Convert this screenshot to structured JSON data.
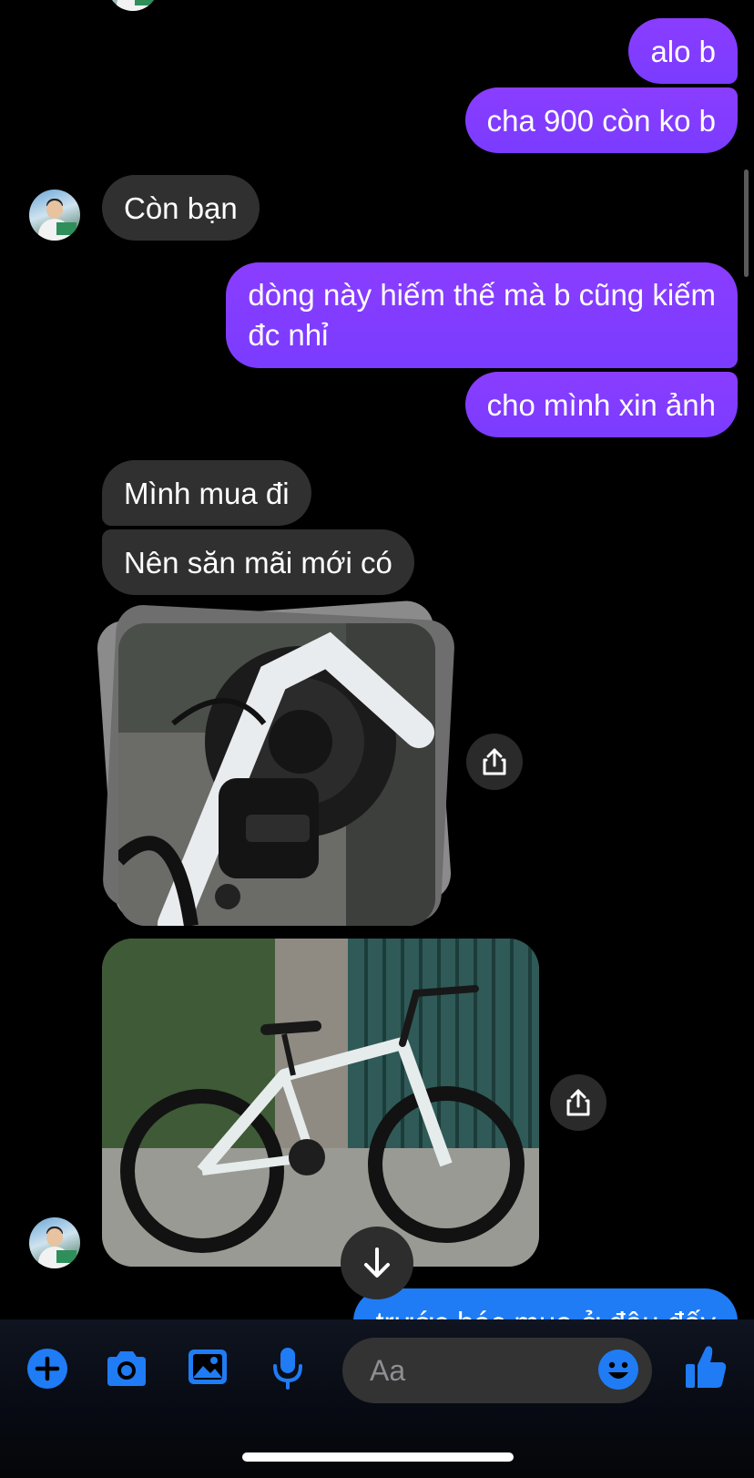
{
  "messages": {
    "m1": "alo b",
    "m2": "cha 900 còn ko b",
    "m3": "Còn bạn",
    "m4_line1": "dòng này hiếm thế mà b cũng kiếm",
    "m4_line2": "đc nhỉ",
    "m5": "cho mình xin ảnh",
    "m6": "Mình mua đi",
    "m7": "Nên săn mãi mới có",
    "m8_partial": "trước bác mua ở đâu đấy"
  },
  "composer": {
    "placeholder": "Aa"
  },
  "icons": {
    "add": "plus-circle-icon",
    "camera": "camera-icon",
    "gallery": "image-icon",
    "mic": "microphone-icon",
    "emoji": "emoji-icon",
    "like": "thumbs-up-icon",
    "share": "share-icon",
    "scroll_down": "arrow-down-icon"
  },
  "colors": {
    "outgoing_bubble": "#7c3cf0",
    "incoming_bubble": "#303030",
    "accent_blue": "#1f7cf5",
    "background": "#000000"
  }
}
